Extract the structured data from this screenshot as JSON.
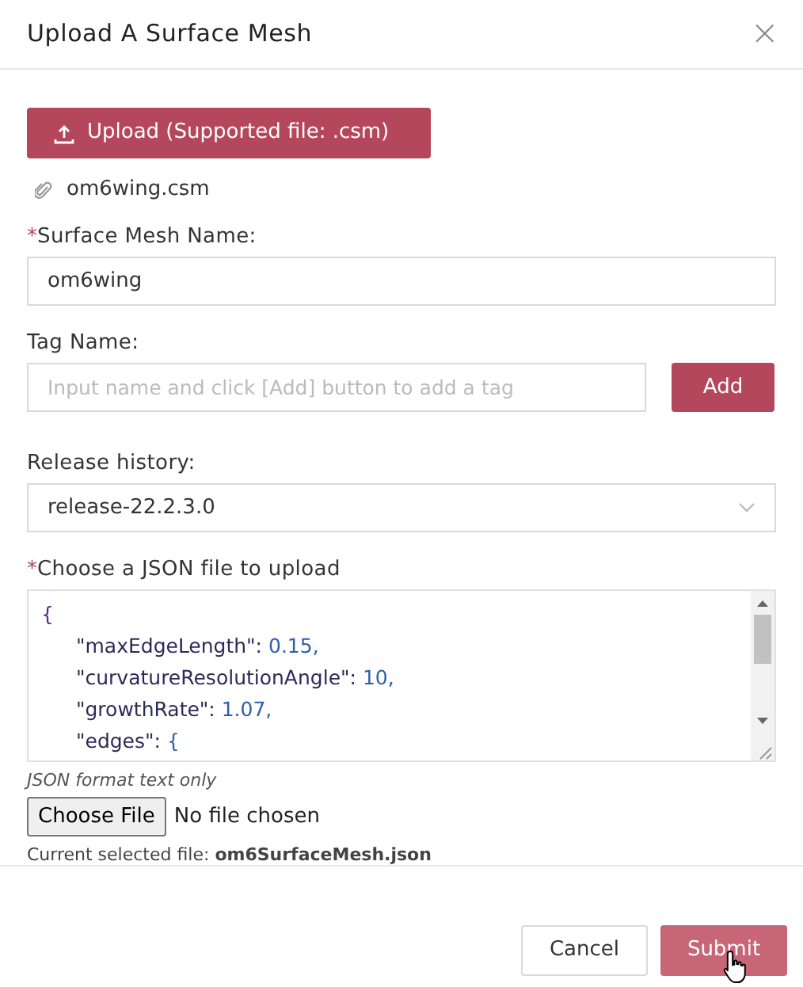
{
  "dialog": {
    "title": "Upload A Surface Mesh",
    "close": "×"
  },
  "upload_button": {
    "label": "Upload (Supported file: .csm)"
  },
  "attached_file": {
    "name": "om6wing.csm"
  },
  "fields": [
    {
      "kind": "text",
      "required_mark": "*",
      "label": "Surface Mesh Name:",
      "value": "om6wing"
    },
    {
      "kind": "tag",
      "label": "Tag Name:",
      "placeholder": "Input name and click [Add] button to add a tag",
      "button": "Add"
    },
    {
      "kind": "select",
      "label": "Release history:",
      "value": "release-22.2.3.0"
    },
    {
      "kind": "code",
      "required_mark": "*",
      "label": "Choose a JSON file to upload",
      "open": "{",
      "children": [
        {
          "key": "\"maxEdgeLength\":",
          "value": "0.15,"
        },
        {
          "key": "\"curvatureResolutionAngle\":",
          "value": "10,"
        },
        {
          "key": "\"growthRate\":",
          "value": "1.07,"
        },
        {
          "key": "\"edges\":",
          "value": "{"
        }
      ],
      "hint": "JSON format text only",
      "file_button": "Choose File",
      "file_status": "No file chosen",
      "current_file": "Current selected file: **om6SurfaceMesh.json**"
    }
  ],
  "footer": {
    "buttons": [
      {
        "label": "Cancel",
        "kind": "secondary"
      },
      {
        "label": "Submit",
        "kind": "primary"
      }
    ]
  }
}
